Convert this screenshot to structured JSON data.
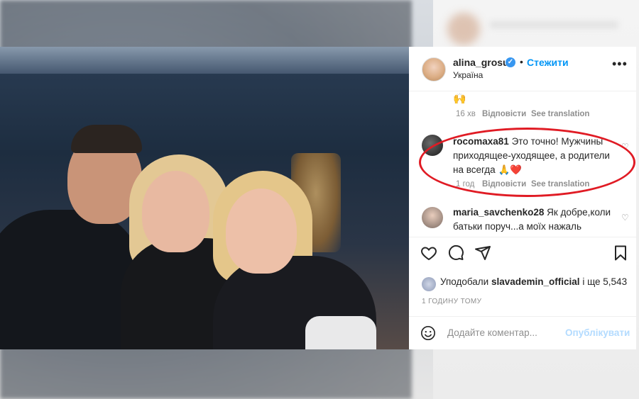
{
  "post": {
    "username": "alina_grosu",
    "verified_mark": "✓",
    "separator": "•",
    "follow_label": "Стежити",
    "location": "Україна",
    "more_label": "•••"
  },
  "comments": [
    {
      "emoji": "🙌",
      "time": "16 хв",
      "reply": "Відповісти",
      "translate": "See translation"
    },
    {
      "username": "rocomaxa81",
      "text": "Это точно! Мужчины приходящее-уходящее, а родители на всегда 🙏❤️",
      "time": "1 год",
      "reply": "Відповісти",
      "translate": "See translation",
      "highlighted": true
    },
    {
      "username": "maria_savchenko28",
      "text": "Як добре,коли батьки поруч...а моїх нажаль"
    }
  ],
  "likes": {
    "prefix": "Уподобали",
    "user": "slavademin_official",
    "suffix": "і ще 5,543"
  },
  "timestamp": "1 ГОДИНУ ТОМУ",
  "comment_box": {
    "placeholder": "Додайте коментар...",
    "publish": "Опублікувати"
  },
  "icons": [
    "heart-icon",
    "comment-icon",
    "share-icon",
    "bookmark-icon",
    "smile-icon",
    "more-icon",
    "like-small-icon"
  ],
  "colors": {
    "accent": "#0095f6",
    "highlight_circle": "#e01b24"
  }
}
